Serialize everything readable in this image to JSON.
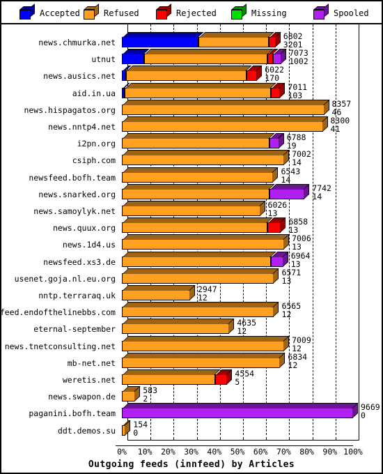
{
  "legend": {
    "items": [
      {
        "label": "Accepted",
        "color": "#0000ff",
        "icon": "cube-icon"
      },
      {
        "label": "Refused",
        "color": "#ffa020",
        "icon": "cube-icon"
      },
      {
        "label": "Rejected",
        "color": "#ff0000",
        "icon": "cube-icon"
      },
      {
        "label": "Missing",
        "color": "#00e000",
        "icon": "cube-icon"
      },
      {
        "label": "Spooled",
        "color": "#b020f0",
        "icon": "cube-icon"
      }
    ]
  },
  "chart_data": {
    "type": "bar",
    "orientation": "horizontal",
    "stacked": true,
    "title": "Outgoing feeds (innfeed) by Articles",
    "xlabel": "Outgoing feeds (innfeed) by Articles",
    "ylabel": "",
    "xlim": [
      0,
      100
    ],
    "xunit": "%",
    "grid": true,
    "legend_position": "top",
    "xtick_labels": [
      "0%",
      "10%",
      "20%",
      "30%",
      "40%",
      "50%",
      "60%",
      "70%",
      "80%",
      "90%",
      "100%"
    ],
    "xtick_values": [
      0,
      10,
      20,
      30,
      40,
      50,
      60,
      70,
      80,
      90,
      100
    ],
    "series_names": [
      "Accepted",
      "Refused",
      "Rejected",
      "Missing",
      "Spooled"
    ],
    "series_colors": [
      "#0000ff",
      "#ffa020",
      "#ff0000",
      "#00e000",
      "#b020f0"
    ],
    "categories": [
      "news.chmurka.net",
      "utnut",
      "news.ausics.net",
      "aid.in.ua",
      "news.hispagatos.org",
      "news.nntp4.net",
      "i2pn.org",
      "csiph.com",
      "newsfeed.bofh.team",
      "news.snarked.org",
      "news.samoylyk.net",
      "news.quux.org",
      "news.1d4.us",
      "newsfeed.xs3.de",
      "usenet.goja.nl.eu.org",
      "nntp.terraraq.uk",
      "newsfeed.endofthelinebbs.com",
      "eternal-september",
      "news.tnetconsulting.net",
      "mb-net.net",
      "weretis.net",
      "news.swapon.de",
      "paganini.bofh.team",
      "ddt.demos.su"
    ],
    "rows": [
      {
        "label": "news.chmurka.net",
        "total": 6802,
        "secondary": 3201,
        "pct": 66.5,
        "segments": [
          {
            "name": "Accepted",
            "pct": 33.0
          },
          {
            "name": "Refused",
            "pct": 30.5
          },
          {
            "name": "Rejected",
            "pct": 3.0
          }
        ]
      },
      {
        "label": "utnut",
        "total": 7073,
        "secondary": 1002,
        "pct": 69.0,
        "segments": [
          {
            "name": "Accepted",
            "pct": 9.5
          },
          {
            "name": "Refused",
            "pct": 53.5
          },
          {
            "name": "Rejected",
            "pct": 2.4
          },
          {
            "name": "Spooled",
            "pct": 3.6
          }
        ]
      },
      {
        "label": "news.ausics.net",
        "total": 6022,
        "secondary": 170,
        "pct": 58.5,
        "segments": [
          {
            "name": "Accepted",
            "pct": 1.8
          },
          {
            "name": "Refused",
            "pct": 52.2
          },
          {
            "name": "Rejected",
            "pct": 4.5
          }
        ]
      },
      {
        "label": "aid.in.ua",
        "total": 7011,
        "secondary": 103,
        "pct": 68.5,
        "segments": [
          {
            "name": "Accepted",
            "pct": 1.2
          },
          {
            "name": "Refused",
            "pct": 63.3
          },
          {
            "name": "Rejected",
            "pct": 4.0
          }
        ]
      },
      {
        "label": "news.hispagatos.org",
        "total": 8357,
        "secondary": 46,
        "pct": 87.5,
        "segments": [
          {
            "name": "Refused",
            "pct": 87.5
          }
        ]
      },
      {
        "label": "news.nntp4.net",
        "total": 8300,
        "secondary": 41,
        "pct": 86.9,
        "segments": [
          {
            "name": "Refused",
            "pct": 86.9
          }
        ]
      },
      {
        "label": "i2pn.org",
        "total": 6788,
        "secondary": 19,
        "pct": 68.0,
        "segments": [
          {
            "name": "Refused",
            "pct": 64.0
          },
          {
            "name": "Spooled",
            "pct": 4.0
          }
        ]
      },
      {
        "label": "csiph.com",
        "total": 7002,
        "secondary": 14,
        "pct": 70.2,
        "segments": [
          {
            "name": "Refused",
            "pct": 70.2
          }
        ]
      },
      {
        "label": "newsfeed.bofh.team",
        "total": 6543,
        "secondary": 14,
        "pct": 65.5,
        "segments": [
          {
            "name": "Refused",
            "pct": 65.5
          }
        ]
      },
      {
        "label": "news.snarked.org",
        "total": 7742,
        "secondary": 14,
        "pct": 79.0,
        "segments": [
          {
            "name": "Refused",
            "pct": 64.0
          },
          {
            "name": "Spooled",
            "pct": 15.0
          }
        ]
      },
      {
        "label": "news.samoylyk.net",
        "total": 6026,
        "secondary": 13,
        "pct": 59.8,
        "segments": [
          {
            "name": "Refused",
            "pct": 59.8
          }
        ]
      },
      {
        "label": "news.quux.org",
        "total": 6858,
        "secondary": 13,
        "pct": 68.8,
        "segments": [
          {
            "name": "Refused",
            "pct": 63.0
          },
          {
            "name": "Rejected",
            "pct": 5.8
          }
        ]
      },
      {
        "label": "news.1d4.us",
        "total": 7006,
        "secondary": 13,
        "pct": 70.2,
        "segments": [
          {
            "name": "Refused",
            "pct": 70.2
          }
        ]
      },
      {
        "label": "newsfeed.xs3.de",
        "total": 6964,
        "secondary": 13,
        "pct": 69.8,
        "segments": [
          {
            "name": "Refused",
            "pct": 64.5
          },
          {
            "name": "Spooled",
            "pct": 5.3
          }
        ]
      },
      {
        "label": "usenet.goja.nl.eu.org",
        "total": 6571,
        "secondary": 13,
        "pct": 65.8,
        "segments": [
          {
            "name": "Refused",
            "pct": 65.8
          }
        ]
      },
      {
        "label": "nntp.terraraq.uk",
        "total": 2947,
        "secondary": 12,
        "pct": 29.5,
        "segments": [
          {
            "name": "Refused",
            "pct": 29.5
          }
        ]
      },
      {
        "label": "newsfeed.endofthelinebbs.com",
        "total": 6565,
        "secondary": 12,
        "pct": 65.8,
        "segments": [
          {
            "name": "Refused",
            "pct": 65.8
          }
        ]
      },
      {
        "label": "eternal-september",
        "total": 4635,
        "secondary": 12,
        "pct": 46.5,
        "segments": [
          {
            "name": "Refused",
            "pct": 46.5
          }
        ]
      },
      {
        "label": "news.tnetconsulting.net",
        "total": 7009,
        "secondary": 12,
        "pct": 70.2,
        "segments": [
          {
            "name": "Refused",
            "pct": 70.2
          }
        ]
      },
      {
        "label": "mb-net.net",
        "total": 6834,
        "secondary": 12,
        "pct": 68.5,
        "segments": [
          {
            "name": "Refused",
            "pct": 68.5
          }
        ]
      },
      {
        "label": "weretis.net",
        "total": 4554,
        "secondary": 5,
        "pct": 45.6,
        "segments": [
          {
            "name": "Refused",
            "pct": 40.5
          },
          {
            "name": "Rejected",
            "pct": 5.1
          }
        ]
      },
      {
        "label": "news.swapon.de",
        "total": 583,
        "secondary": 2,
        "pct": 5.8,
        "segments": [
          {
            "name": "Refused",
            "pct": 5.8
          }
        ]
      },
      {
        "label": "paganini.bofh.team",
        "total": 9669,
        "secondary": 0,
        "pct": 100.0,
        "segments": [
          {
            "name": "Spooled",
            "pct": 100.0
          }
        ]
      },
      {
        "label": "ddt.demos.su",
        "total": 154,
        "secondary": 0,
        "pct": 1.6,
        "segments": [
          {
            "name": "Refused",
            "pct": 1.6
          }
        ]
      }
    ]
  }
}
